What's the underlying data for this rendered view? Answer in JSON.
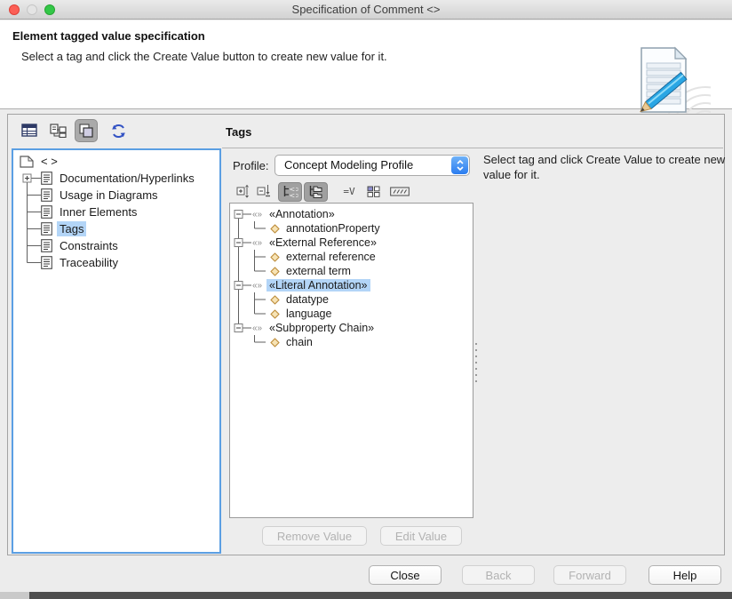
{
  "window": {
    "title": "Specification of Comment <>"
  },
  "header": {
    "title": "Element tagged value specification",
    "subtitle": "Select a tag and click the Create Value button to create new value for it."
  },
  "left_tree": {
    "root": "< >",
    "items": [
      {
        "label": "Documentation/Hyperlinks"
      },
      {
        "label": "Usage in Diagrams"
      },
      {
        "label": "Inner Elements"
      },
      {
        "label": "Tags",
        "selected": true
      },
      {
        "label": "Constraints"
      },
      {
        "label": "Traceability"
      }
    ]
  },
  "tags": {
    "title": "Tags",
    "profile_label": "Profile:",
    "profile_value": "Concept Modeling Profile",
    "hint": "Select tag and click Create Value to create new value for it.",
    "stereotype_icon": "«»",
    "values_icon_label": "=V",
    "tree": [
      {
        "label": "«Annotation»",
        "children": [
          "annotationProperty"
        ]
      },
      {
        "label": "«External Reference»",
        "children": [
          "external reference",
          "external term"
        ]
      },
      {
        "label": "«Literal Annotation»",
        "selected": true,
        "children": [
          "datatype",
          "language"
        ]
      },
      {
        "label": "«Subproperty Chain»",
        "children": [
          "chain"
        ]
      }
    ],
    "remove_button": "Remove Value",
    "edit_button": "Edit Value"
  },
  "footer": {
    "close": "Close",
    "back": "Back",
    "forward": "Forward",
    "help": "Help"
  },
  "colors": {
    "selection": "#b3d5f7",
    "focus_border": "#5b9fe3",
    "tag_diamond_fill": "#f7e3b4",
    "tag_diamond_stroke": "#bf8f3f",
    "refresh_blue": "#3353c4"
  }
}
